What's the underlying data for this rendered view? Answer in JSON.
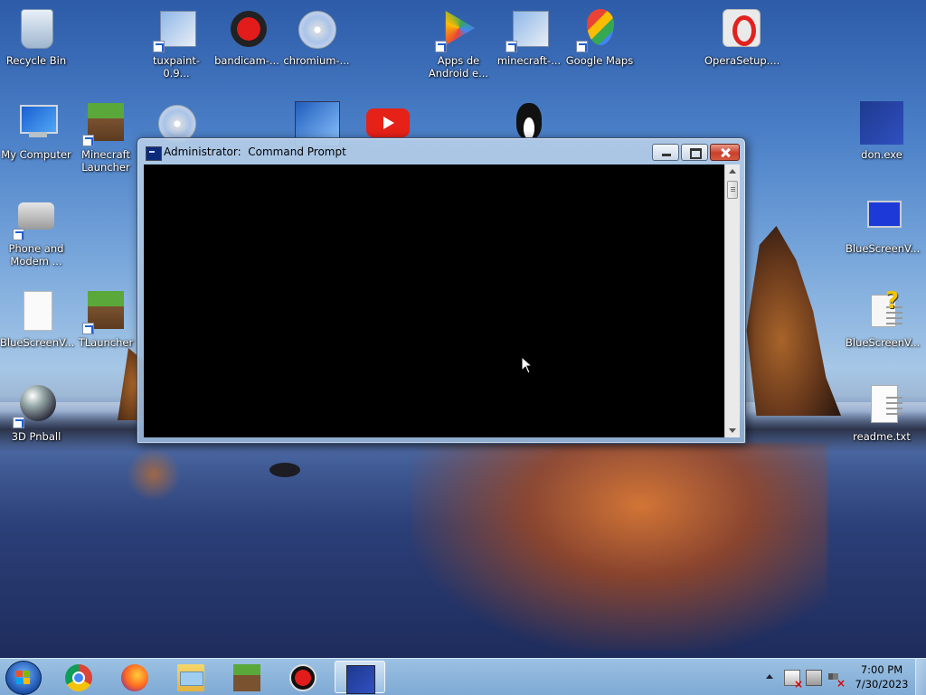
{
  "desktop": {
    "icons": [
      {
        "id": "recycle-bin",
        "label": "Recycle Bin",
        "icon": "recycle-bin-icon"
      },
      {
        "id": "tuxpaint",
        "label": "tuxpaint-0.9...",
        "icon": "installer-icon"
      },
      {
        "id": "bandicam",
        "label": "bandicam-...",
        "icon": "installer-icon"
      },
      {
        "id": "chromium",
        "label": "chromium-...",
        "icon": "installer-icon"
      },
      {
        "id": "apps-android",
        "label": "Apps de\nAndroid e...",
        "icon": "play-store-icon"
      },
      {
        "id": "minecraft-setup",
        "label": "minecraft-...",
        "icon": "installer-icon"
      },
      {
        "id": "google-maps",
        "label": "Google Maps",
        "icon": "maps-pin-icon"
      },
      {
        "id": "opera-setup",
        "label": "OperaSetup....",
        "icon": "opera-icon"
      },
      {
        "id": "my-computer",
        "label": "My Computer",
        "icon": "computer-icon"
      },
      {
        "id": "minecraft-launcher",
        "label": "Minecraft\nLauncher",
        "icon": "grass-block-icon"
      },
      {
        "id": "don-exe",
        "label": "don.exe",
        "icon": "app-icon"
      },
      {
        "id": "phone-modem",
        "label": "Phone and\nModem ...",
        "icon": "phone-icon"
      },
      {
        "id": "bluescreenview-1",
        "label": "BlueScreenV...",
        "icon": "monitor-icon"
      },
      {
        "id": "bluescreenview-2",
        "label": "BlueScreenV...",
        "icon": "document-icon"
      },
      {
        "id": "tlauncher",
        "label": "TLauncher",
        "icon": "grass-block-icon"
      },
      {
        "id": "bluescreenview-3",
        "label": "BlueScreenV...",
        "icon": "help-document-icon"
      },
      {
        "id": "pinball",
        "label": "3D Pnball",
        "icon": "pinball-icon"
      },
      {
        "id": "readme",
        "label": "readme.txt",
        "icon": "text-file-icon"
      }
    ]
  },
  "cmd_window": {
    "title": "Administrator:  Command Prompt",
    "minimize": "minimize",
    "maximize": "maximize",
    "close": "close",
    "console_text": ""
  },
  "taskbar": {
    "pinned": [
      "chrome",
      "firefox",
      "file-explorer",
      "minecraft",
      "recorder",
      "don.exe"
    ],
    "clock": {
      "time": "7:00 PM",
      "date": "7/30/2023"
    }
  },
  "colors": {
    "console_bg": "#000000",
    "close_button": "#c9402a",
    "taskbar": "#8fb8df"
  }
}
